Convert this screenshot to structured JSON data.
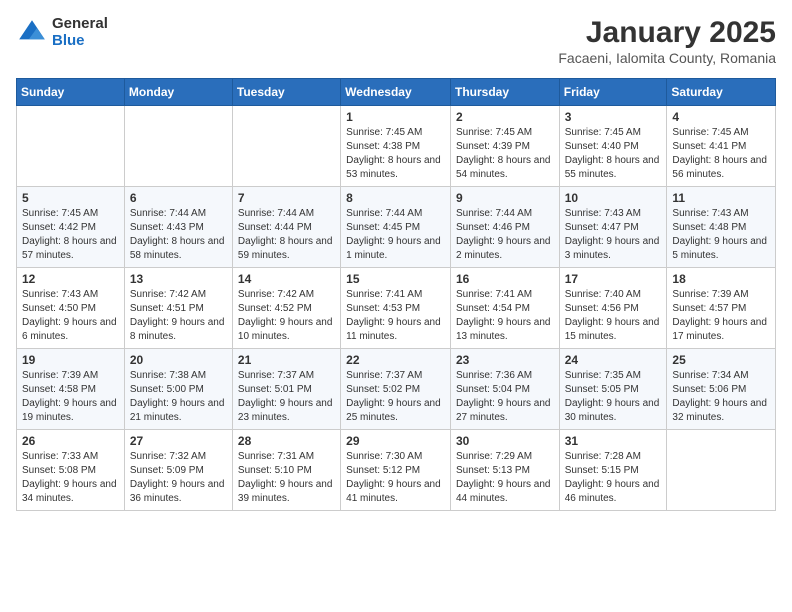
{
  "logo": {
    "general": "General",
    "blue": "Blue"
  },
  "header": {
    "month": "January 2025",
    "location": "Facaeni, Ialomita County, Romania"
  },
  "weekdays": [
    "Sunday",
    "Monday",
    "Tuesday",
    "Wednesday",
    "Thursday",
    "Friday",
    "Saturday"
  ],
  "weeks": [
    [
      {
        "day": "",
        "info": ""
      },
      {
        "day": "",
        "info": ""
      },
      {
        "day": "",
        "info": ""
      },
      {
        "day": "1",
        "info": "Sunrise: 7:45 AM\nSunset: 4:38 PM\nDaylight: 8 hours and 53 minutes."
      },
      {
        "day": "2",
        "info": "Sunrise: 7:45 AM\nSunset: 4:39 PM\nDaylight: 8 hours and 54 minutes."
      },
      {
        "day": "3",
        "info": "Sunrise: 7:45 AM\nSunset: 4:40 PM\nDaylight: 8 hours and 55 minutes."
      },
      {
        "day": "4",
        "info": "Sunrise: 7:45 AM\nSunset: 4:41 PM\nDaylight: 8 hours and 56 minutes."
      }
    ],
    [
      {
        "day": "5",
        "info": "Sunrise: 7:45 AM\nSunset: 4:42 PM\nDaylight: 8 hours and 57 minutes."
      },
      {
        "day": "6",
        "info": "Sunrise: 7:44 AM\nSunset: 4:43 PM\nDaylight: 8 hours and 58 minutes."
      },
      {
        "day": "7",
        "info": "Sunrise: 7:44 AM\nSunset: 4:44 PM\nDaylight: 8 hours and 59 minutes."
      },
      {
        "day": "8",
        "info": "Sunrise: 7:44 AM\nSunset: 4:45 PM\nDaylight: 9 hours and 1 minute."
      },
      {
        "day": "9",
        "info": "Sunrise: 7:44 AM\nSunset: 4:46 PM\nDaylight: 9 hours and 2 minutes."
      },
      {
        "day": "10",
        "info": "Sunrise: 7:43 AM\nSunset: 4:47 PM\nDaylight: 9 hours and 3 minutes."
      },
      {
        "day": "11",
        "info": "Sunrise: 7:43 AM\nSunset: 4:48 PM\nDaylight: 9 hours and 5 minutes."
      }
    ],
    [
      {
        "day": "12",
        "info": "Sunrise: 7:43 AM\nSunset: 4:50 PM\nDaylight: 9 hours and 6 minutes."
      },
      {
        "day": "13",
        "info": "Sunrise: 7:42 AM\nSunset: 4:51 PM\nDaylight: 9 hours and 8 minutes."
      },
      {
        "day": "14",
        "info": "Sunrise: 7:42 AM\nSunset: 4:52 PM\nDaylight: 9 hours and 10 minutes."
      },
      {
        "day": "15",
        "info": "Sunrise: 7:41 AM\nSunset: 4:53 PM\nDaylight: 9 hours and 11 minutes."
      },
      {
        "day": "16",
        "info": "Sunrise: 7:41 AM\nSunset: 4:54 PM\nDaylight: 9 hours and 13 minutes."
      },
      {
        "day": "17",
        "info": "Sunrise: 7:40 AM\nSunset: 4:56 PM\nDaylight: 9 hours and 15 minutes."
      },
      {
        "day": "18",
        "info": "Sunrise: 7:39 AM\nSunset: 4:57 PM\nDaylight: 9 hours and 17 minutes."
      }
    ],
    [
      {
        "day": "19",
        "info": "Sunrise: 7:39 AM\nSunset: 4:58 PM\nDaylight: 9 hours and 19 minutes."
      },
      {
        "day": "20",
        "info": "Sunrise: 7:38 AM\nSunset: 5:00 PM\nDaylight: 9 hours and 21 minutes."
      },
      {
        "day": "21",
        "info": "Sunrise: 7:37 AM\nSunset: 5:01 PM\nDaylight: 9 hours and 23 minutes."
      },
      {
        "day": "22",
        "info": "Sunrise: 7:37 AM\nSunset: 5:02 PM\nDaylight: 9 hours and 25 minutes."
      },
      {
        "day": "23",
        "info": "Sunrise: 7:36 AM\nSunset: 5:04 PM\nDaylight: 9 hours and 27 minutes."
      },
      {
        "day": "24",
        "info": "Sunrise: 7:35 AM\nSunset: 5:05 PM\nDaylight: 9 hours and 30 minutes."
      },
      {
        "day": "25",
        "info": "Sunrise: 7:34 AM\nSunset: 5:06 PM\nDaylight: 9 hours and 32 minutes."
      }
    ],
    [
      {
        "day": "26",
        "info": "Sunrise: 7:33 AM\nSunset: 5:08 PM\nDaylight: 9 hours and 34 minutes."
      },
      {
        "day": "27",
        "info": "Sunrise: 7:32 AM\nSunset: 5:09 PM\nDaylight: 9 hours and 36 minutes."
      },
      {
        "day": "28",
        "info": "Sunrise: 7:31 AM\nSunset: 5:10 PM\nDaylight: 9 hours and 39 minutes."
      },
      {
        "day": "29",
        "info": "Sunrise: 7:30 AM\nSunset: 5:12 PM\nDaylight: 9 hours and 41 minutes."
      },
      {
        "day": "30",
        "info": "Sunrise: 7:29 AM\nSunset: 5:13 PM\nDaylight: 9 hours and 44 minutes."
      },
      {
        "day": "31",
        "info": "Sunrise: 7:28 AM\nSunset: 5:15 PM\nDaylight: 9 hours and 46 minutes."
      },
      {
        "day": "",
        "info": ""
      }
    ]
  ]
}
